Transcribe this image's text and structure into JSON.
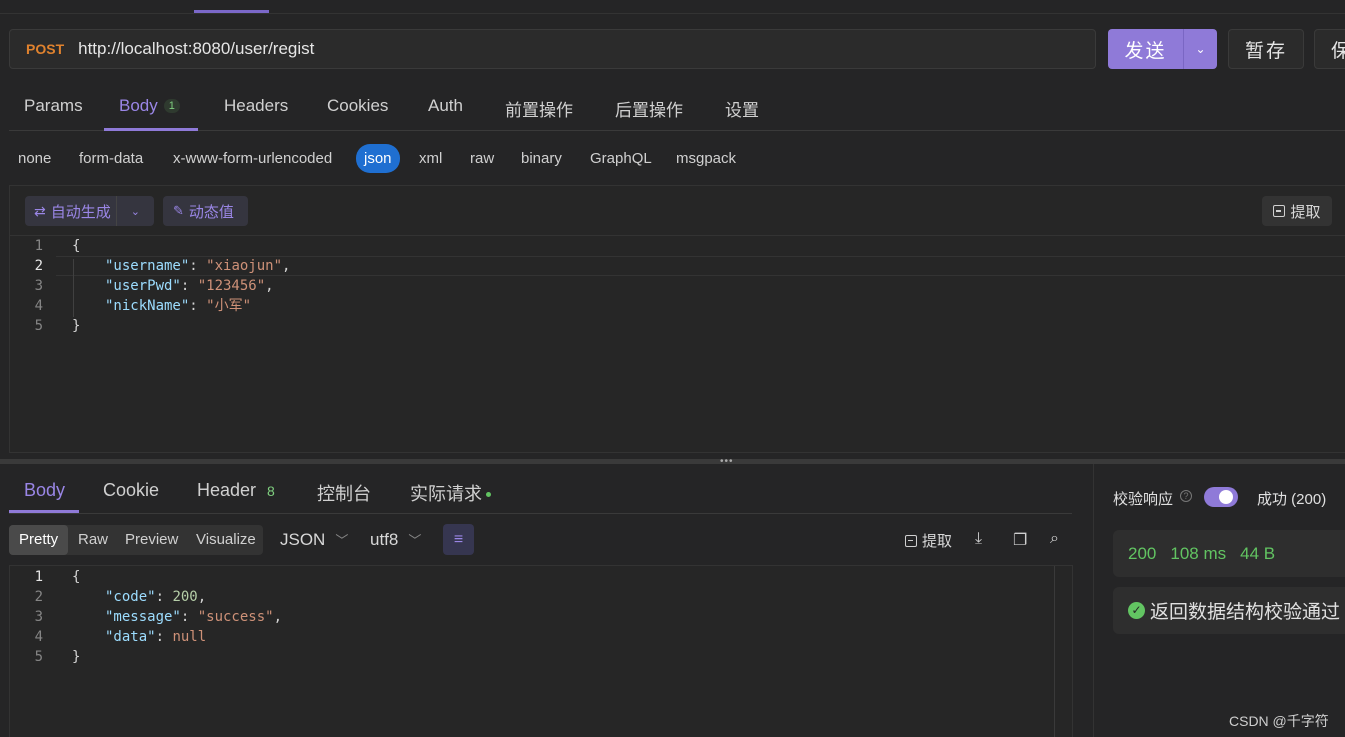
{
  "request": {
    "method": "POST",
    "url": "http://localhost:8080/user/regist",
    "send_label": "发送",
    "stash_label": "暂存",
    "save_label": "保"
  },
  "request_tabs": [
    {
      "label": "Params"
    },
    {
      "label": "Body",
      "badge": "1",
      "active": true
    },
    {
      "label": "Headers"
    },
    {
      "label": "Cookies"
    },
    {
      "label": "Auth"
    },
    {
      "label": "前置操作"
    },
    {
      "label": "后置操作"
    },
    {
      "label": "设置"
    }
  ],
  "body_types": [
    "none",
    "form-data",
    "x-www-form-urlencoded",
    "json",
    "xml",
    "raw",
    "binary",
    "GraphQL",
    "msgpack"
  ],
  "body_type_selected": "json",
  "editor_toolbar": {
    "auto_generate": "自动生成",
    "dynamic_value": "动态值",
    "extract": "提取"
  },
  "request_body": {
    "line_numbers": [
      "1",
      "2",
      "3",
      "4",
      "5"
    ],
    "open": "{",
    "close": "}",
    "fields": [
      {
        "key": "\"username\"",
        "value": "\"xiaojun\"",
        "comma": ","
      },
      {
        "key": "\"userPwd\"",
        "value": "\"123456\"",
        "comma": ","
      },
      {
        "key": "\"nickName\"",
        "value": "\"小军\"",
        "comma": ""
      }
    ]
  },
  "response_tabs": [
    {
      "label": "Body",
      "active": true
    },
    {
      "label": "Cookie"
    },
    {
      "label": "Header",
      "badge": "8"
    },
    {
      "label": "控制台"
    },
    {
      "label": "实际请求"
    }
  ],
  "view_modes": [
    "Pretty",
    "Raw",
    "Preview",
    "Visualize"
  ],
  "view_mode_selected": "Pretty",
  "format": "JSON",
  "encoding": "utf8",
  "response_toolbar": {
    "extract": "提取"
  },
  "response_body": {
    "line_numbers": [
      "1",
      "2",
      "3",
      "4",
      "5"
    ],
    "open": "{",
    "close": "}",
    "fields": [
      {
        "key": "\"code\"",
        "value": "200",
        "type": "number",
        "comma": ","
      },
      {
        "key": "\"message\"",
        "value": "\"success\"",
        "type": "string",
        "comma": ","
      },
      {
        "key": "\"data\"",
        "value": "null",
        "type": "null",
        "comma": ""
      }
    ]
  },
  "validation": {
    "label": "校验响应",
    "help": "?",
    "toggle_on": true,
    "status": "成功 (200)",
    "status_code": "200",
    "time": "108 ms",
    "size": "44 B",
    "schema_result": "返回数据结构校验通过"
  },
  "watermark": "CSDN @千字符",
  "colors": {
    "accent": "#8f7ad8",
    "method": "#e0822e",
    "success": "#62c462",
    "json_chip": "#1f6fd1"
  }
}
